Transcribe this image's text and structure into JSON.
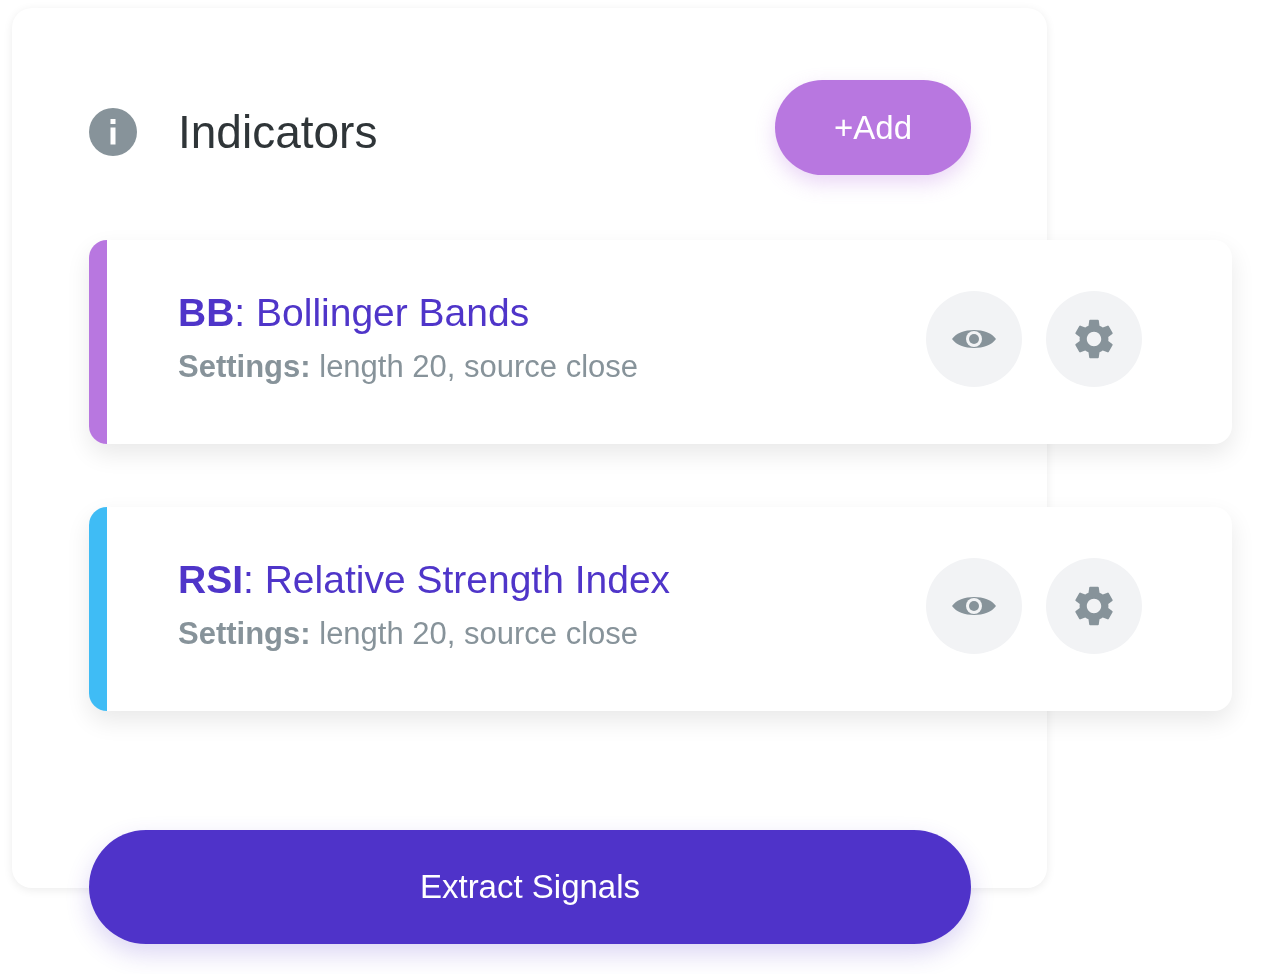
{
  "header": {
    "title": "Indicators",
    "add_button": "+Add"
  },
  "indicators": [
    {
      "title": "**BB**: Bollinger Bands",
      "settings": "**Settings:** length 20, source close",
      "color": "#b877e0"
    },
    {
      "title": "**RSI**: Relative Strength Index",
      "settings": "**Settings:** length 20, source close",
      "color": "#3fbcf5"
    }
  ],
  "extract_button": "Extract Signals"
}
